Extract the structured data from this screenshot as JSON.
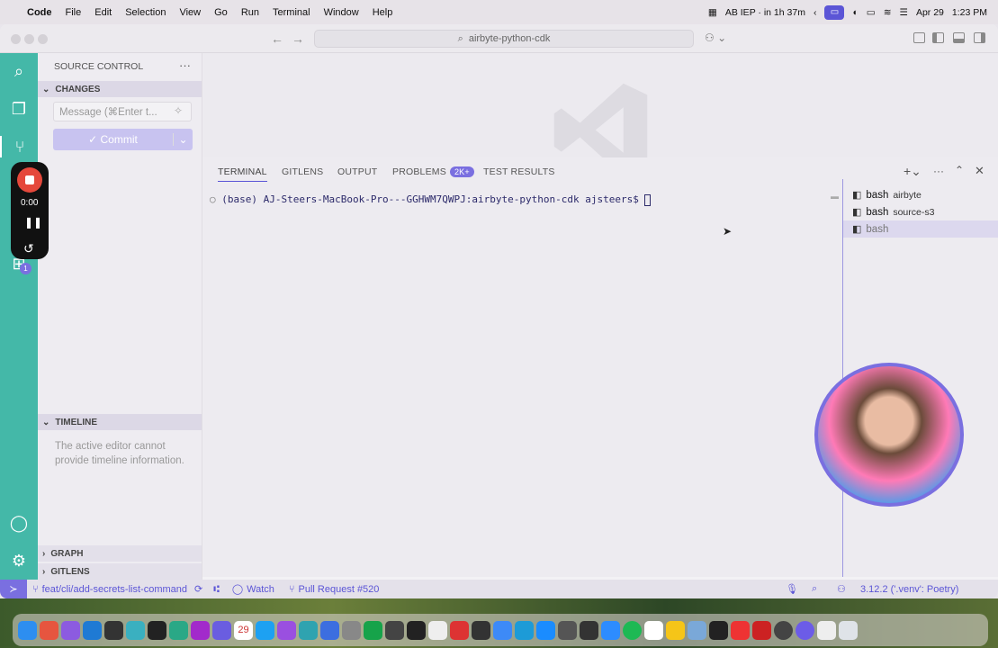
{
  "menubar": {
    "app": "Code",
    "items": [
      "File",
      "Edit",
      "Selection",
      "View",
      "Go",
      "Run",
      "Terminal",
      "Window",
      "Help"
    ],
    "status_text": "AB IEP · in 1h 37m",
    "date": "Apr 29",
    "time": "1:23 PM"
  },
  "titlebar": {
    "search": "airbyte-python-cdk"
  },
  "sidebar": {
    "title": "SOURCE CONTROL",
    "changes": "CHANGES",
    "message_placeholder": "Message (⌘Enter t...",
    "commit_label": "✓ Commit",
    "timeline": "TIMELINE",
    "timeline_text": "The active editor cannot provide timeline information.",
    "graph": "GRAPH",
    "gitlens": "GITLENS"
  },
  "recorder": {
    "time": "0:00"
  },
  "activity": {
    "badge": "1"
  },
  "panel": {
    "tabs": [
      "TERMINAL",
      "GITLENS",
      "OUTPUT",
      "PROBLEMS",
      "TEST RESULTS"
    ],
    "problems_badge": "2K+",
    "prompt": "(base) AJ-Steers-MacBook-Pro---GGHWM7QWPJ:airbyte-python-cdk ajsteers$ ",
    "terminals": [
      {
        "name": "bash",
        "detail": "airbyte"
      },
      {
        "name": "bash",
        "detail": "source-s3"
      },
      {
        "name": "bash",
        "detail": ""
      }
    ]
  },
  "statusbar": {
    "branch": "feat/cli/add-secrets-list-command",
    "watch": "Watch",
    "pull_request": "Pull Request #520",
    "python": "3.12.2 ('.venv': Poetry)"
  },
  "dock": {
    "calendar_day": "29"
  }
}
